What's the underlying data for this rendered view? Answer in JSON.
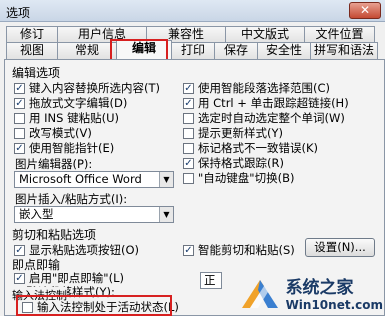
{
  "window": {
    "title": "选项",
    "close_symbol": "✕"
  },
  "tabs_back": [
    "修订",
    "用户信息",
    "兼容性",
    "中文版式",
    "文件位置"
  ],
  "tabs_front": [
    "视图",
    "常规",
    "编辑",
    "打印",
    "保存",
    "安全性",
    "拼写和语法"
  ],
  "active_tab": "编辑",
  "edit_options": {
    "heading": "编辑选项",
    "left": [
      {
        "label": "键入内容替换所选内容(T)",
        "checked": true
      },
      {
        "label": "拖放式文字编辑(D)",
        "checked": true
      },
      {
        "label": "用 INS 键粘贴(U)",
        "checked": false
      },
      {
        "label": "改写模式(V)",
        "checked": false
      },
      {
        "label": "使用智能指针(E)",
        "checked": true
      }
    ],
    "right": [
      {
        "label": "使用智能段落选择范围(C)",
        "checked": true
      },
      {
        "label": "用 Ctrl + 单击跟踪超链接(H)",
        "checked": true
      },
      {
        "label": "选定时自动选定整个单词(W)",
        "checked": false
      },
      {
        "label": "提示更新样式(Y)",
        "checked": false
      },
      {
        "label": "标记格式不一致错误(K)",
        "checked": false
      },
      {
        "label": "保持格式跟踪(R)",
        "checked": true
      },
      {
        "label": "\"自动键盘\"切换(B)",
        "checked": false
      }
    ],
    "picture_editor_label": "图片编辑器(P):",
    "picture_editor_value": "Microsoft Office Word",
    "insert_paste_label": "图片插入/粘贴方式(I):",
    "insert_paste_value": "嵌入型"
  },
  "cut_paste": {
    "heading": "剪切和粘贴选项",
    "show_paste_buttons": {
      "label": "显示粘贴选项按钮(O)",
      "checked": true
    },
    "smart_cut_paste": {
      "label": "智能剪切和粘贴(S)",
      "checked": true
    },
    "settings_button": "设置(N)..."
  },
  "click_and_type": {
    "heading": "即点即输",
    "enable": {
      "label": "启用\"即点即输\"(L)",
      "checked": true
    },
    "default_style_label": "默认段落样式(Y):",
    "default_style_value": "正"
  },
  "ime": {
    "heading": "输入法控制",
    "active": {
      "label": "输入法控制处于活动状态(L)",
      "checked": false
    }
  },
  "watermark": {
    "brand": "系统之家",
    "site": "Win10net.com"
  },
  "colors": {
    "highlight": "#d72020"
  }
}
